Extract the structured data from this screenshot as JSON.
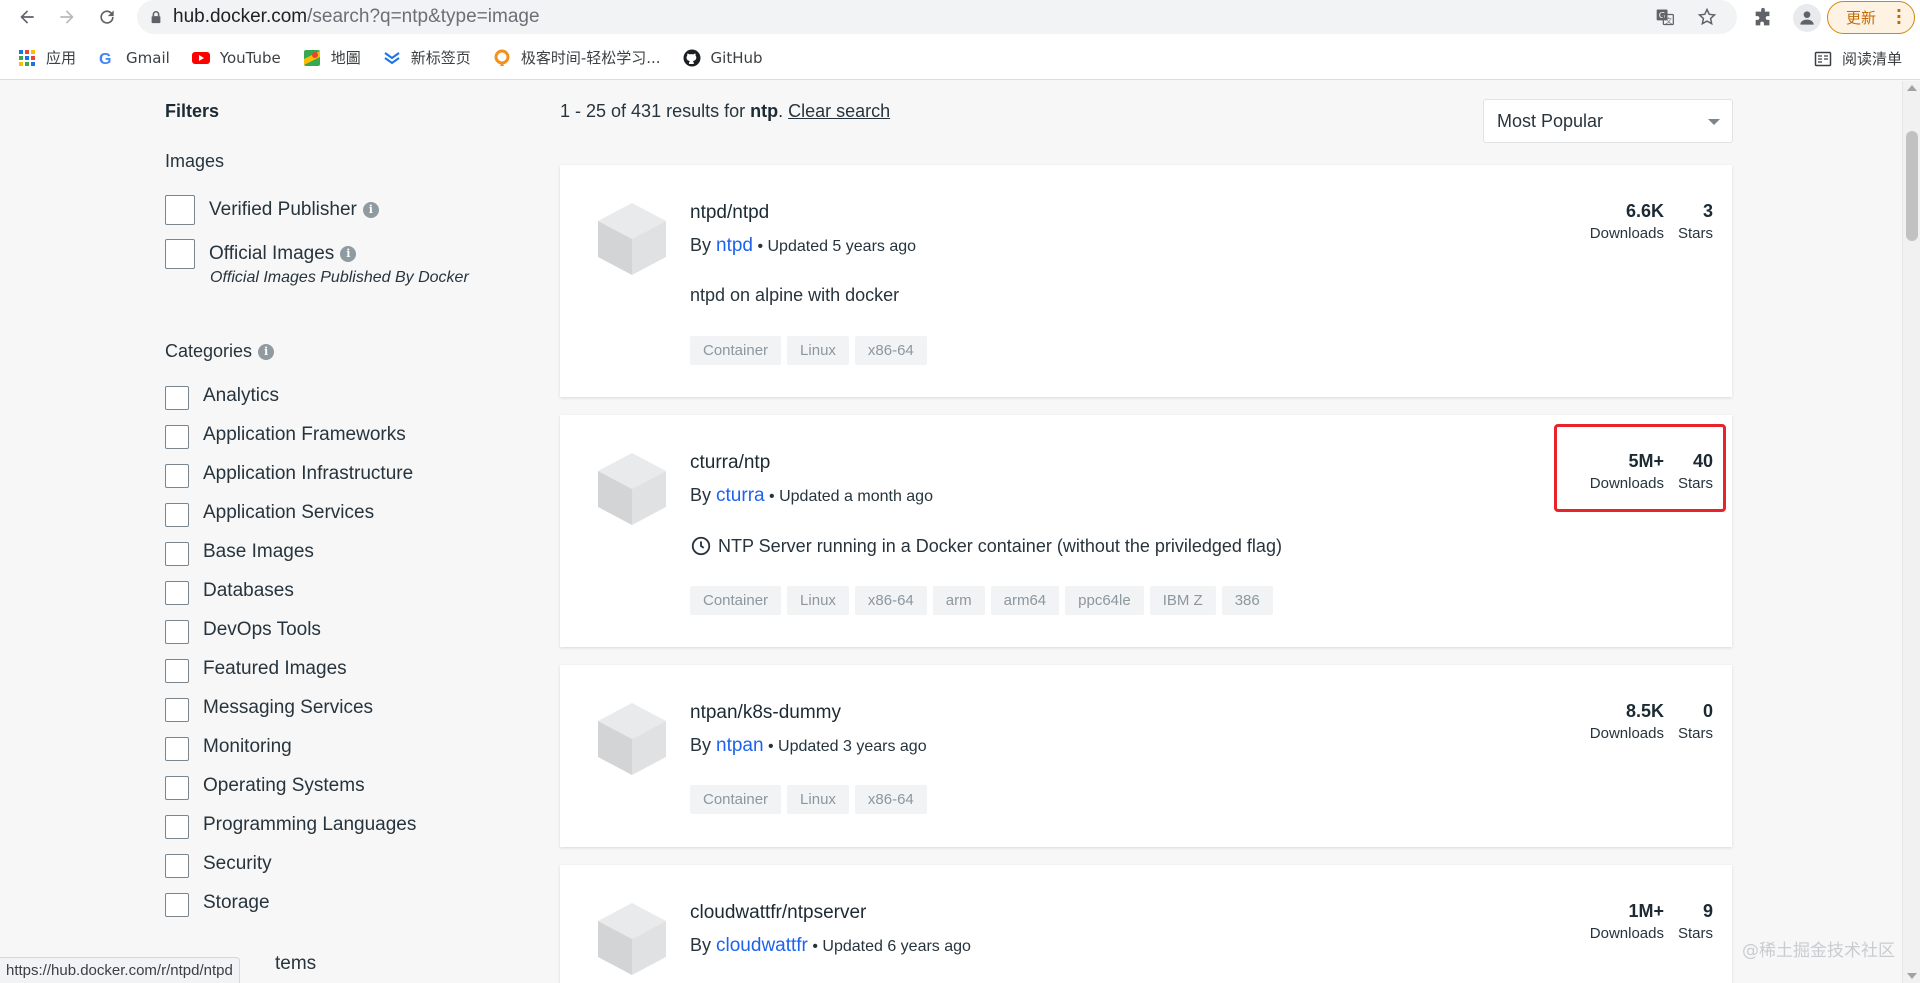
{
  "browser": {
    "url_host": "hub.docker.com",
    "url_rest": "/search?q=ntp&type=image",
    "update_label": "更新",
    "bookmarks": [
      "应用",
      "Gmail",
      "YouTube",
      "地圖",
      "新标签页",
      "极客时间-轻松学习...",
      "GitHub"
    ],
    "reading_list": "阅读清单"
  },
  "filters": {
    "title": "Filters",
    "images_heading": "Images",
    "verified_publisher": "Verified Publisher",
    "official_images": "Official Images",
    "official_note": "Official Images Published By Docker",
    "categories_heading": "Categories",
    "categories": [
      "Analytics",
      "Application Frameworks",
      "Application Infrastructure",
      "Application Services",
      "Base Images",
      "Databases",
      "DevOps Tools",
      "Featured Images",
      "Messaging Services",
      "Monitoring",
      "Operating Systems",
      "Programming Languages",
      "Security",
      "Storage"
    ],
    "partial_next": "tems"
  },
  "results": {
    "summary_prefix": "1 - 25 of 431 results for ",
    "query": "ntp",
    "clear": "Clear search",
    "sort": "Most Popular",
    "downloads_label": "Downloads",
    "stars_label": "Stars",
    "cards": [
      {
        "name": "ntpd/ntpd",
        "by": "By ",
        "publisher": "ntpd",
        "updated": " • Updated 5 years ago",
        "desc": "ntpd on alpine with docker",
        "tags": [
          "Container",
          "Linux",
          "x86-64"
        ],
        "downloads": "6.6K",
        "stars": "3"
      },
      {
        "name": "cturra/ntp",
        "by": "By ",
        "publisher": "cturra",
        "updated": " • Updated a month ago",
        "desc": "NTP Server running in a Docker container (without the priviledged flag)",
        "tags": [
          "Container",
          "Linux",
          "x86-64",
          "arm",
          "arm64",
          "ppc64le",
          "IBM Z",
          "386"
        ],
        "downloads": "5M+",
        "stars": "40"
      },
      {
        "name": "ntpan/k8s-dummy",
        "by": "By ",
        "publisher": "ntpan",
        "updated": " • Updated 3 years ago",
        "desc": "",
        "tags": [
          "Container",
          "Linux",
          "x86-64"
        ],
        "downloads": "8.5K",
        "stars": "0"
      },
      {
        "name": "cloudwattfr/ntpserver",
        "by": "By ",
        "publisher": "cloudwattfr",
        "updated": " • Updated 6 years ago",
        "desc": "",
        "tags": [],
        "downloads": "1M+",
        "stars": "9"
      }
    ]
  },
  "status_url": "https://hub.docker.com/r/ntpd/ntpd",
  "watermark": "@稀土掘金技术社区"
}
